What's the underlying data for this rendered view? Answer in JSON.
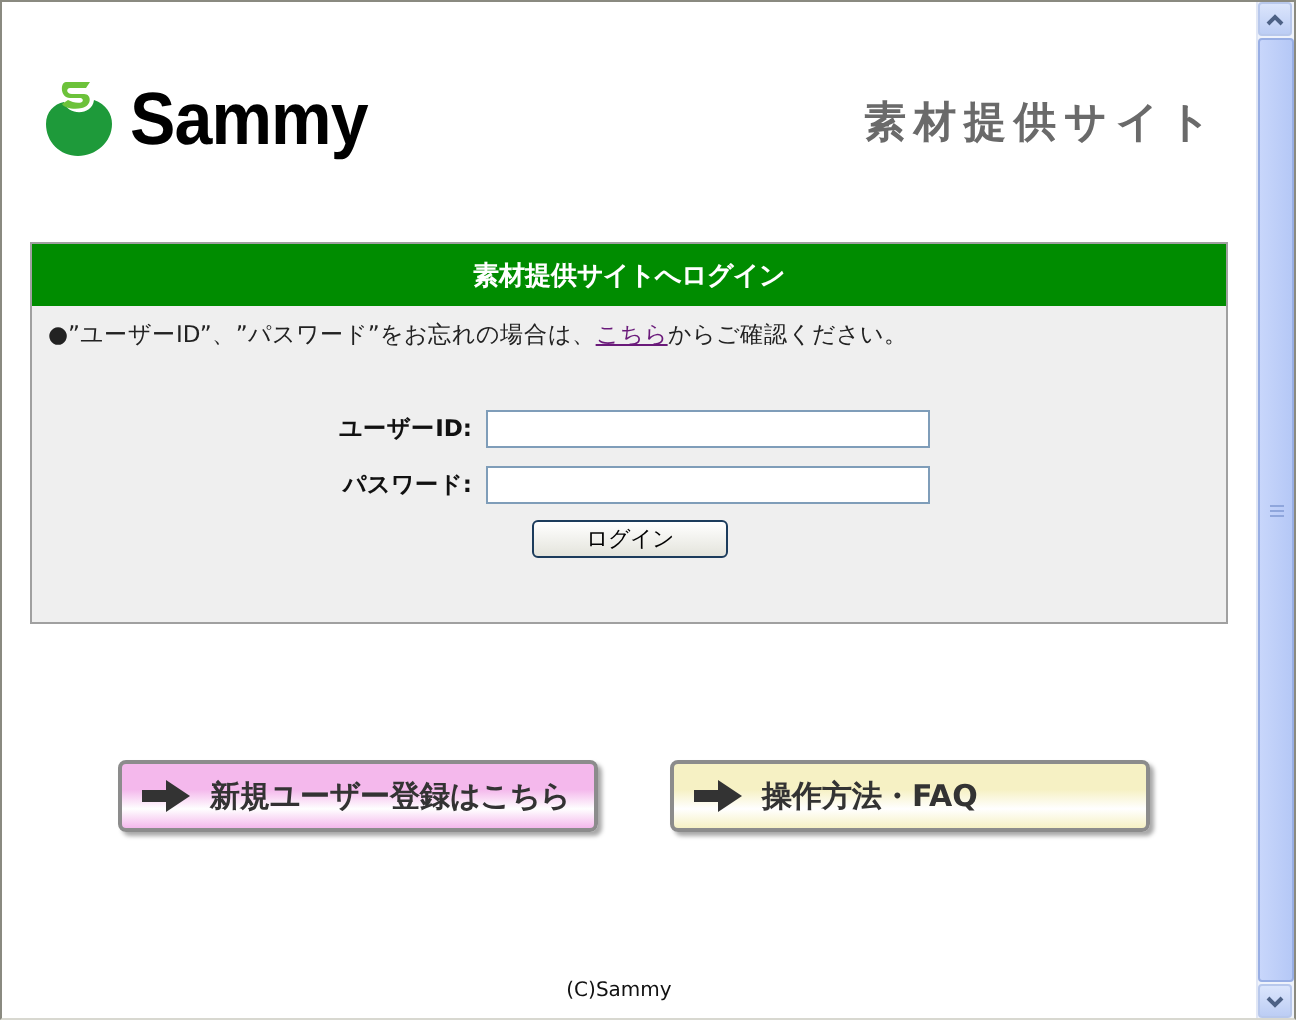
{
  "header": {
    "logo_text": "Sammy",
    "site_title": "素材提供サイト"
  },
  "login_panel": {
    "title": "素材提供サイトへログイン",
    "notice": {
      "before": "●”ユーザーID”、”パスワード”をお忘れの場合は、",
      "link": "こちら",
      "after": "からご確認ください。"
    },
    "fields": [
      {
        "label": "ユーザーID:"
      },
      {
        "label": "パスワード:"
      }
    ],
    "submit": "ログイン"
  },
  "link_buttons": [
    {
      "label": "新規ユーザー登録はこちら",
      "color": "#f4b8ec"
    },
    {
      "label": "操作方法・FAQ",
      "color": "#f6f1c4"
    }
  ],
  "footer": "(C)Sammy"
}
